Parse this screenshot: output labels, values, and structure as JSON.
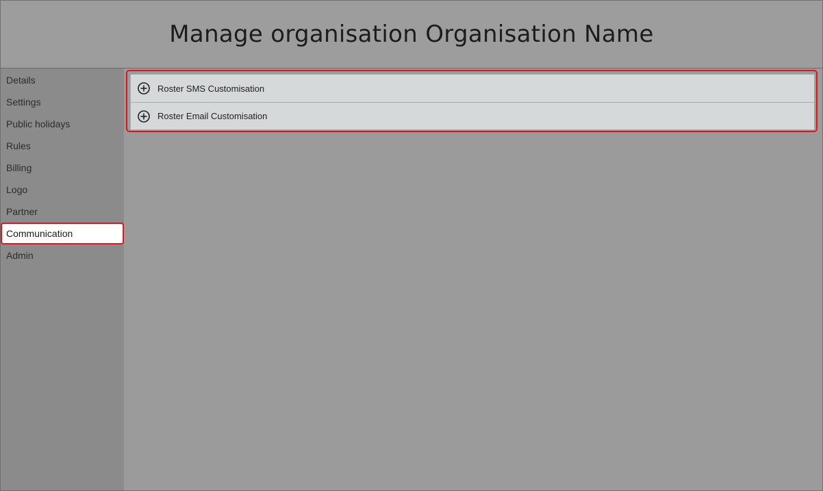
{
  "header": {
    "title": "Manage organisation Organisation Name"
  },
  "sidebar": {
    "items": [
      {
        "label": "Details"
      },
      {
        "label": "Settings"
      },
      {
        "label": "Public holidays"
      },
      {
        "label": "Rules"
      },
      {
        "label": "Billing"
      },
      {
        "label": "Logo"
      },
      {
        "label": "Partner"
      },
      {
        "label": "Communication",
        "active": true
      },
      {
        "label": "Admin"
      }
    ]
  },
  "main": {
    "sections": [
      {
        "label": "Roster SMS Customisation",
        "icon": "plus-circle-icon"
      },
      {
        "label": "Roster Email Customisation",
        "icon": "plus-circle-icon"
      }
    ]
  },
  "colors": {
    "highlight": "#e0141b",
    "accordion_bg": "#d5d9da",
    "sidebar_bg": "#8a8b8a",
    "page_bg": "#9b9b9b"
  }
}
